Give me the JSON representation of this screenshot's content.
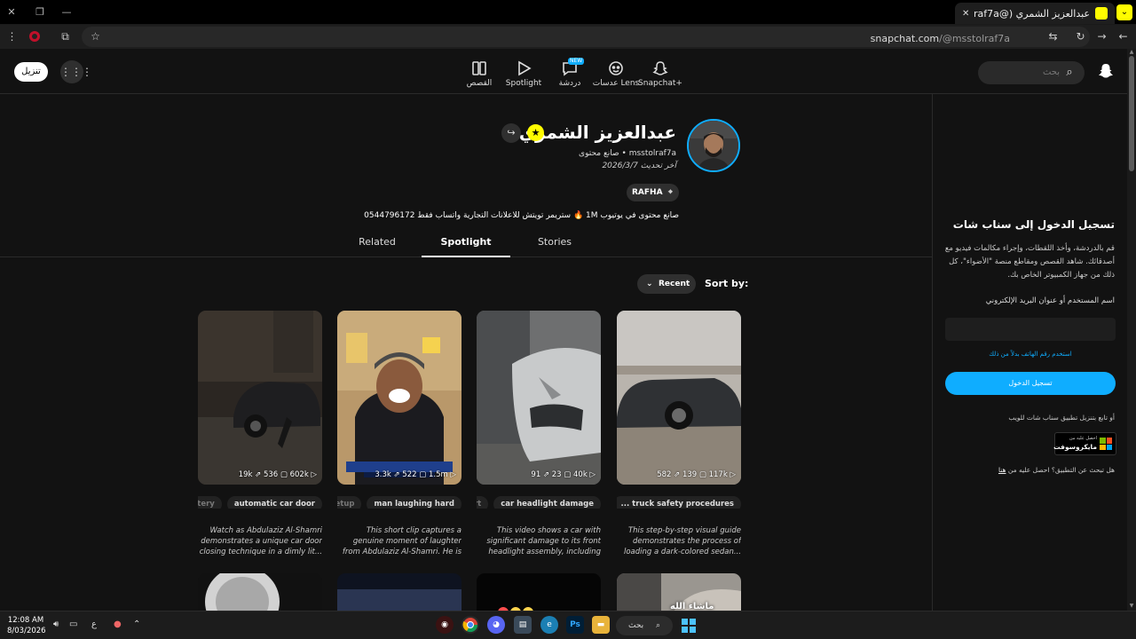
{
  "browser": {
    "tab_title": "عبدالعزيز الشمري (@msstolraf7a",
    "url_host": "snapchat.com",
    "url_path": "/@msstolraf7a"
  },
  "nav": {
    "download_label": "تنزيل",
    "items": [
      {
        "label": "القصص",
        "icon": "stories-icon"
      },
      {
        "label": "Spotlight",
        "icon": "spotlight-play-icon"
      },
      {
        "label": "دردشة",
        "icon": "chat-icon",
        "badge": "NEW"
      },
      {
        "label": "عدسات Lens",
        "icon": "lens-icon"
      },
      {
        "label": "Snapchat+",
        "icon": "snapchat-plus-icon"
      }
    ],
    "search_placeholder": "بحث"
  },
  "profile": {
    "name": "عبدالعزيز الشمري",
    "handle": "msstolraf7a",
    "role": "صانع محتوى",
    "updated": "آخر تحديث 2026/3/7",
    "location": "RAFHA",
    "bio": "صانع محتوى في يوتيوب 1M 🔥 ستريمر تويتش للاعلانات التجارية واتساب فقط 0544796172"
  },
  "tabs": [
    {
      "label": "Related"
    },
    {
      "label": "Spotlight"
    },
    {
      "label": "Stories"
    }
  ],
  "sort": {
    "label": "Sort by:",
    "value": "Recent"
  },
  "cards": [
    {
      "stats": "19k ⇗ 536 ▢ 602k ▷",
      "chips": [
        "automatic car door",
        "mystery"
      ],
      "desc": "Watch as Abdulaziz Al-Shamri demonstrates a unique car door closing technique in a dimly lit..."
    },
    {
      "stats": "3.3k ⇗ 522 ▢ 1.5m ▷",
      "chips": [
        "man laughing hard",
        "setup"
      ],
      "desc": "This short clip captures a genuine moment of laughter from Abdulaziz Al-Shamri. He is seen..."
    },
    {
      "stats": "91 ⇗ 23 ▢ 40k ▷",
      "chips": [
        "car headlight damage",
        "alert"
      ],
      "desc": "This video shows a car with significant damage to its front headlight assembly, including a..."
    },
    {
      "stats": "582 ⇗ 139 ▢ 117k ▷",
      "chips": [
        "truck safety procedures ..."
      ],
      "desc": "This step-by-step visual guide demonstrates the process of loading a dark-colored sedan..."
    }
  ],
  "card4_overlay": "ماشاء الله",
  "sidebar": {
    "title": "تسجيل الدخول إلى سناب شات",
    "desc": "قم بالدردشة، وأخذ اللقطات، وإجراء مكالمات فيديو مع أصدقائك. شاهد القصص ومقاطع منصة \"الأضواء\"، كل ذلك من جهاز الكمبيوتر الخاص بك.",
    "field_label": "اسم المستخدم أو عنوان البريد الإلكتروني",
    "phone_link": "استخدم رقم الهاتف بدلاً من ذلك",
    "login_button": "تسجيل الدخول",
    "or_text": "أو تابع بتنزيل تطبيق سناب شات للويب",
    "ms_line1": "احصل عليه من",
    "ms_line2": "مايكروسوفت",
    "help_text": "هل تبحث عن التطبيق؟ احصل عليه من",
    "help_link": "هنا"
  },
  "taskbar": {
    "time": "12:08 AM",
    "date": "8/03/2026",
    "lang": "ع",
    "search_label": "بحث"
  },
  "colors": {
    "accent": "#0fadff",
    "snap_yellow": "#fffc00",
    "bg": "#121212"
  }
}
